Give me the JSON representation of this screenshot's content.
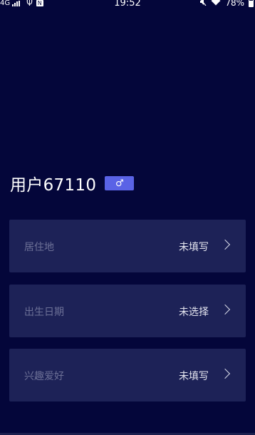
{
  "status_bar": {
    "network": "4G",
    "usb_icon": "usb-icon",
    "nfc_label": "N",
    "time": "19:52",
    "battery": "78%"
  },
  "profile": {
    "username": "用户67110",
    "gender_symbol": "♂"
  },
  "fields": [
    {
      "label": "居住地",
      "value": "未填写"
    },
    {
      "label": "出生日期",
      "value": "未选择"
    },
    {
      "label": "兴趣爱好",
      "value": "未填写"
    }
  ],
  "colors": {
    "background": "#04063a",
    "card": "#1d2257",
    "badge": "#5a63e6"
  }
}
